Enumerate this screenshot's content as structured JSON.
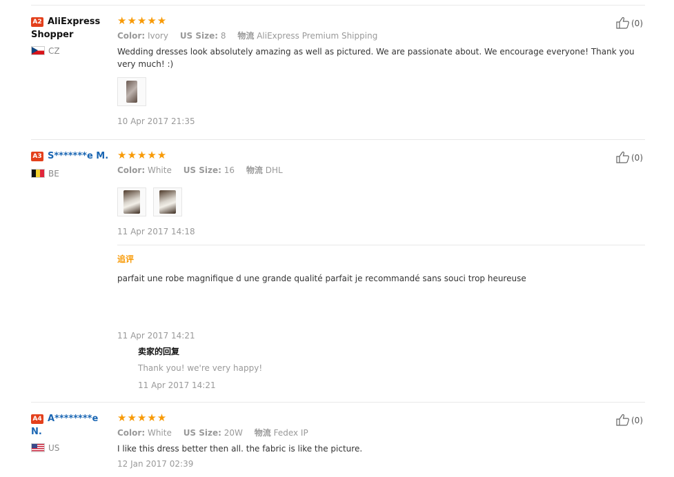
{
  "reviews": [
    {
      "badge": "A2",
      "name": "AliExpress Shopper",
      "country": "CZ",
      "stars": "★★★★★",
      "attrs": {
        "color_label": "Color:",
        "color_value": "Ivory",
        "size_label": "US Size:",
        "size_value": "8",
        "ship_label": "物流",
        "ship_value": "AliExpress Premium Shipping"
      },
      "text": "Wedding dresses look absolutely amazing as well as pictured. We are passionate about. We encourage everyone! Thank you very much! :)",
      "date": "10 Apr 2017 21:35",
      "likes": "(0)"
    },
    {
      "badge": "A3",
      "name": "S*******e M.",
      "country": "BE",
      "stars": "★★★★★",
      "attrs": {
        "color_label": "Color:",
        "color_value": "White",
        "size_label": "US Size:",
        "size_value": "16",
        "ship_label": "物流",
        "ship_value": "DHL"
      },
      "date": "11 Apr 2017 14:18",
      "likes": "(0)",
      "followup": {
        "title": "追评",
        "text": "parfait une robe magnifique d une grande qualité parfait je recommandé sans souci trop heureuse",
        "date": "11 Apr 2017 14:21"
      },
      "reply": {
        "title": "卖家的回复",
        "text": "Thank you! we're very happy!",
        "date": "11 Apr 2017 14:21"
      }
    },
    {
      "badge": "A4",
      "name": "A********e N.",
      "country": "US",
      "stars": "★★★★★",
      "attrs": {
        "color_label": "Color:",
        "color_value": "White",
        "size_label": "US Size:",
        "size_value": "20W",
        "ship_label": "物流",
        "ship_value": "Fedex IP"
      },
      "text": "I like this dress better then all. the fabric is like the picture.",
      "date": "12 Jan 2017 02:39",
      "likes": "(0)"
    }
  ],
  "colors": {
    "star": "#f89a06",
    "badge": "#e3401c",
    "username_link": "#1a66b3",
    "muted": "#999999"
  }
}
